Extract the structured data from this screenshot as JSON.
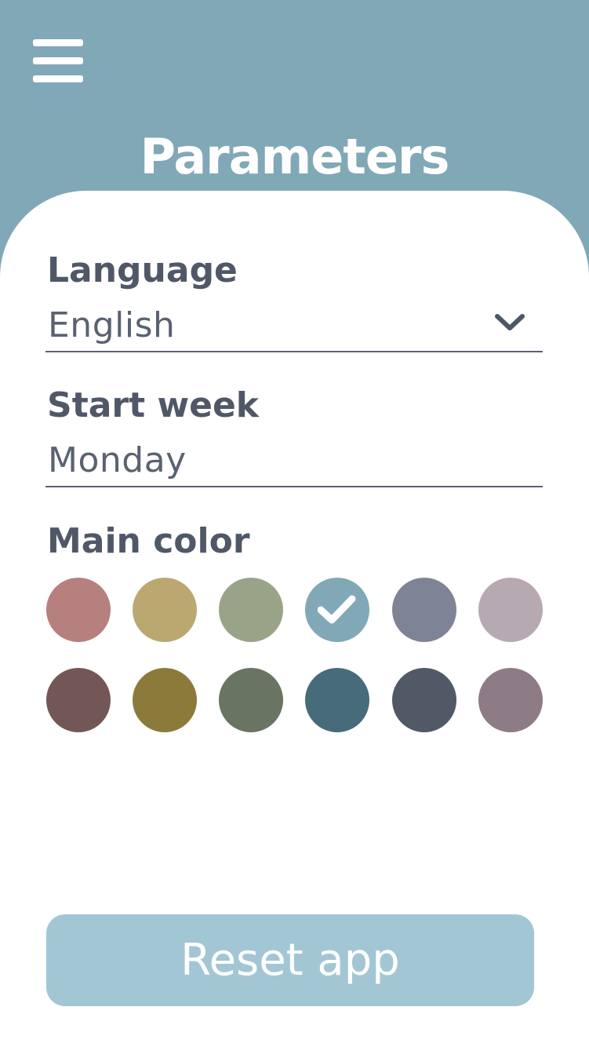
{
  "header": {
    "title": "Parameters",
    "background_color": "#81a8b6",
    "menu_icon": "hamburger-menu-icon"
  },
  "settings": {
    "language": {
      "label": "Language",
      "value": "English",
      "icon": "chevron-down-icon"
    },
    "start_week": {
      "label": "Start week",
      "value": "Monday"
    },
    "main_color": {
      "label": "Main color",
      "selected": "#81a8b6",
      "options": [
        "#b5807e",
        "#bba871",
        "#99a388",
        "#81a8b6",
        "#7e8495",
        "#b6a9b2",
        "#725756",
        "#8c7a3a",
        "#6a7463",
        "#476b7a",
        "#515866",
        "#8d7c86"
      ],
      "selected_icon": "checkmark-icon"
    }
  },
  "reset_button": {
    "label": "Reset app",
    "color": "#a2c6d4"
  }
}
